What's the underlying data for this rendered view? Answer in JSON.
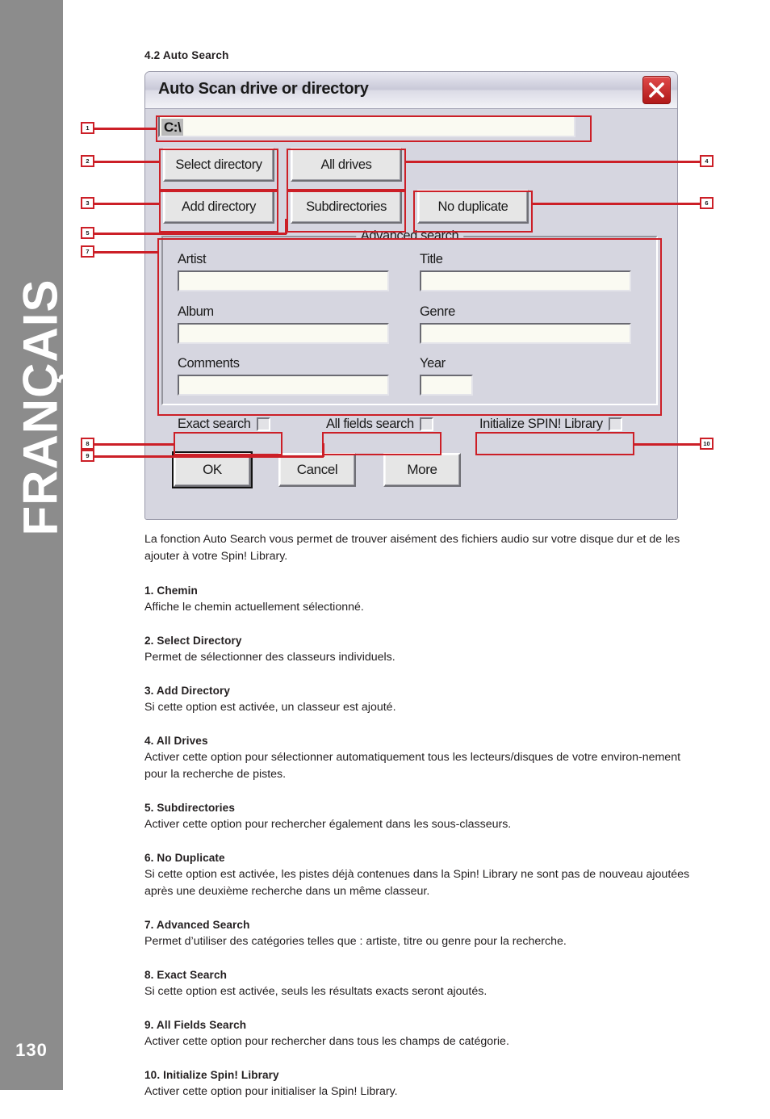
{
  "sidebar": {
    "language_label": "FRANÇAIS",
    "page_number": "130",
    "band_color": "#8c8c8c"
  },
  "section": {
    "heading": "4.2 Auto Search"
  },
  "dialog": {
    "title": "Auto Scan drive or directory",
    "close_icon": "close-x-icon",
    "path_value": "C:\\",
    "buttons": {
      "select_directory": "Select directory",
      "all_drives": "All drives",
      "add_directory": "Add directory",
      "subdirectories": "Subdirectories",
      "no_duplicate": "No duplicate"
    },
    "advanced_search": {
      "legend": "Advanced search",
      "fields": [
        {
          "label": "Artist",
          "value": ""
        },
        {
          "label": "Title",
          "value": ""
        },
        {
          "label": "Album",
          "value": ""
        },
        {
          "label": "Genre",
          "value": ""
        },
        {
          "label": "Comments",
          "value": ""
        },
        {
          "label": "Year",
          "value": ""
        }
      ]
    },
    "checkboxes": [
      {
        "label": "Exact search",
        "checked": false
      },
      {
        "label": "All fields search",
        "checked": false
      },
      {
        "label": "Initialize SPIN! Library",
        "checked": false
      }
    ],
    "action_buttons": {
      "ok": "OK",
      "cancel": "Cancel",
      "more": "More"
    }
  },
  "callouts": {
    "accent_color": "#cc1f27",
    "markers": [
      "1",
      "2",
      "3",
      "5",
      "7",
      "8",
      "9",
      "4",
      "6",
      "10"
    ]
  },
  "body": {
    "intro": "La fonction Auto Search vous permet de trouver aisément des fichiers audio sur votre disque dur et de les ajouter à votre Spin! Library.",
    "items": [
      {
        "title": "1. Chemin",
        "text": "Affiche le chemin actuellement sélectionné."
      },
      {
        "title": "2. Select Directory",
        "text": "Permet de sélectionner des classeurs individuels."
      },
      {
        "title": "3. Add Directory",
        "text": "Si cette option est activée, un classeur est ajouté."
      },
      {
        "title": "4. All Drives",
        "text": "Activer cette option pour sélectionner automatiquement tous les lecteurs/disques de votre environ-nement pour la recherche de pistes."
      },
      {
        "title": "5. Subdirectories",
        "text": "Activer cette option pour rechercher également dans les sous-classeurs."
      },
      {
        "title": "6. No Duplicate",
        "text": "Si cette option est activée, les pistes déjà contenues dans la Spin! Library ne sont pas de nouveau ajoutées après une deuxième recherche dans un même classeur."
      },
      {
        "title": "7. Advanced Search",
        "text": "Permet d’utiliser des catégories telles que : artiste, titre ou genre pour la recherche."
      },
      {
        "title": "8. Exact Search",
        "text": "Si cette option est activée, seuls les résultats exacts seront ajoutés."
      },
      {
        "title": "9. All Fields Search",
        "text": "Activer cette option pour rechercher dans tous les champs de catégorie."
      },
      {
        "title": "10. Initialize Spin! Library",
        "text": "Activer cette option pour initialiser la Spin! Library."
      }
    ]
  }
}
